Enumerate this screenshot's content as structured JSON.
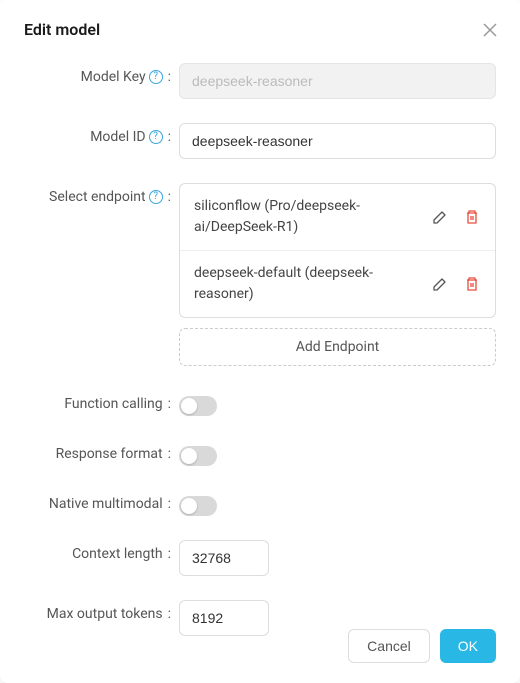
{
  "modal": {
    "title": "Edit model",
    "close": "×"
  },
  "form": {
    "model_key": {
      "label": "Model Key",
      "placeholder": "deepseek-reasoner",
      "value": ""
    },
    "model_id": {
      "label": "Model ID",
      "value": "deepseek-reasoner"
    },
    "endpoint": {
      "label": "Select endpoint",
      "items": [
        "siliconflow (Pro/deepseek-ai/DeepSeek-R1)",
        "deepseek-default (deepseek-reasoner)"
      ],
      "add_label": "Add Endpoint"
    },
    "function_calling": {
      "label": "Function calling"
    },
    "response_format": {
      "label": "Response format"
    },
    "native_multimodal": {
      "label": "Native multimodal"
    },
    "context_length": {
      "label": "Context length",
      "value": "32768"
    },
    "max_output_tokens": {
      "label": "Max output tokens",
      "value": "8192"
    }
  },
  "footer": {
    "cancel": "Cancel",
    "ok": "OK"
  }
}
